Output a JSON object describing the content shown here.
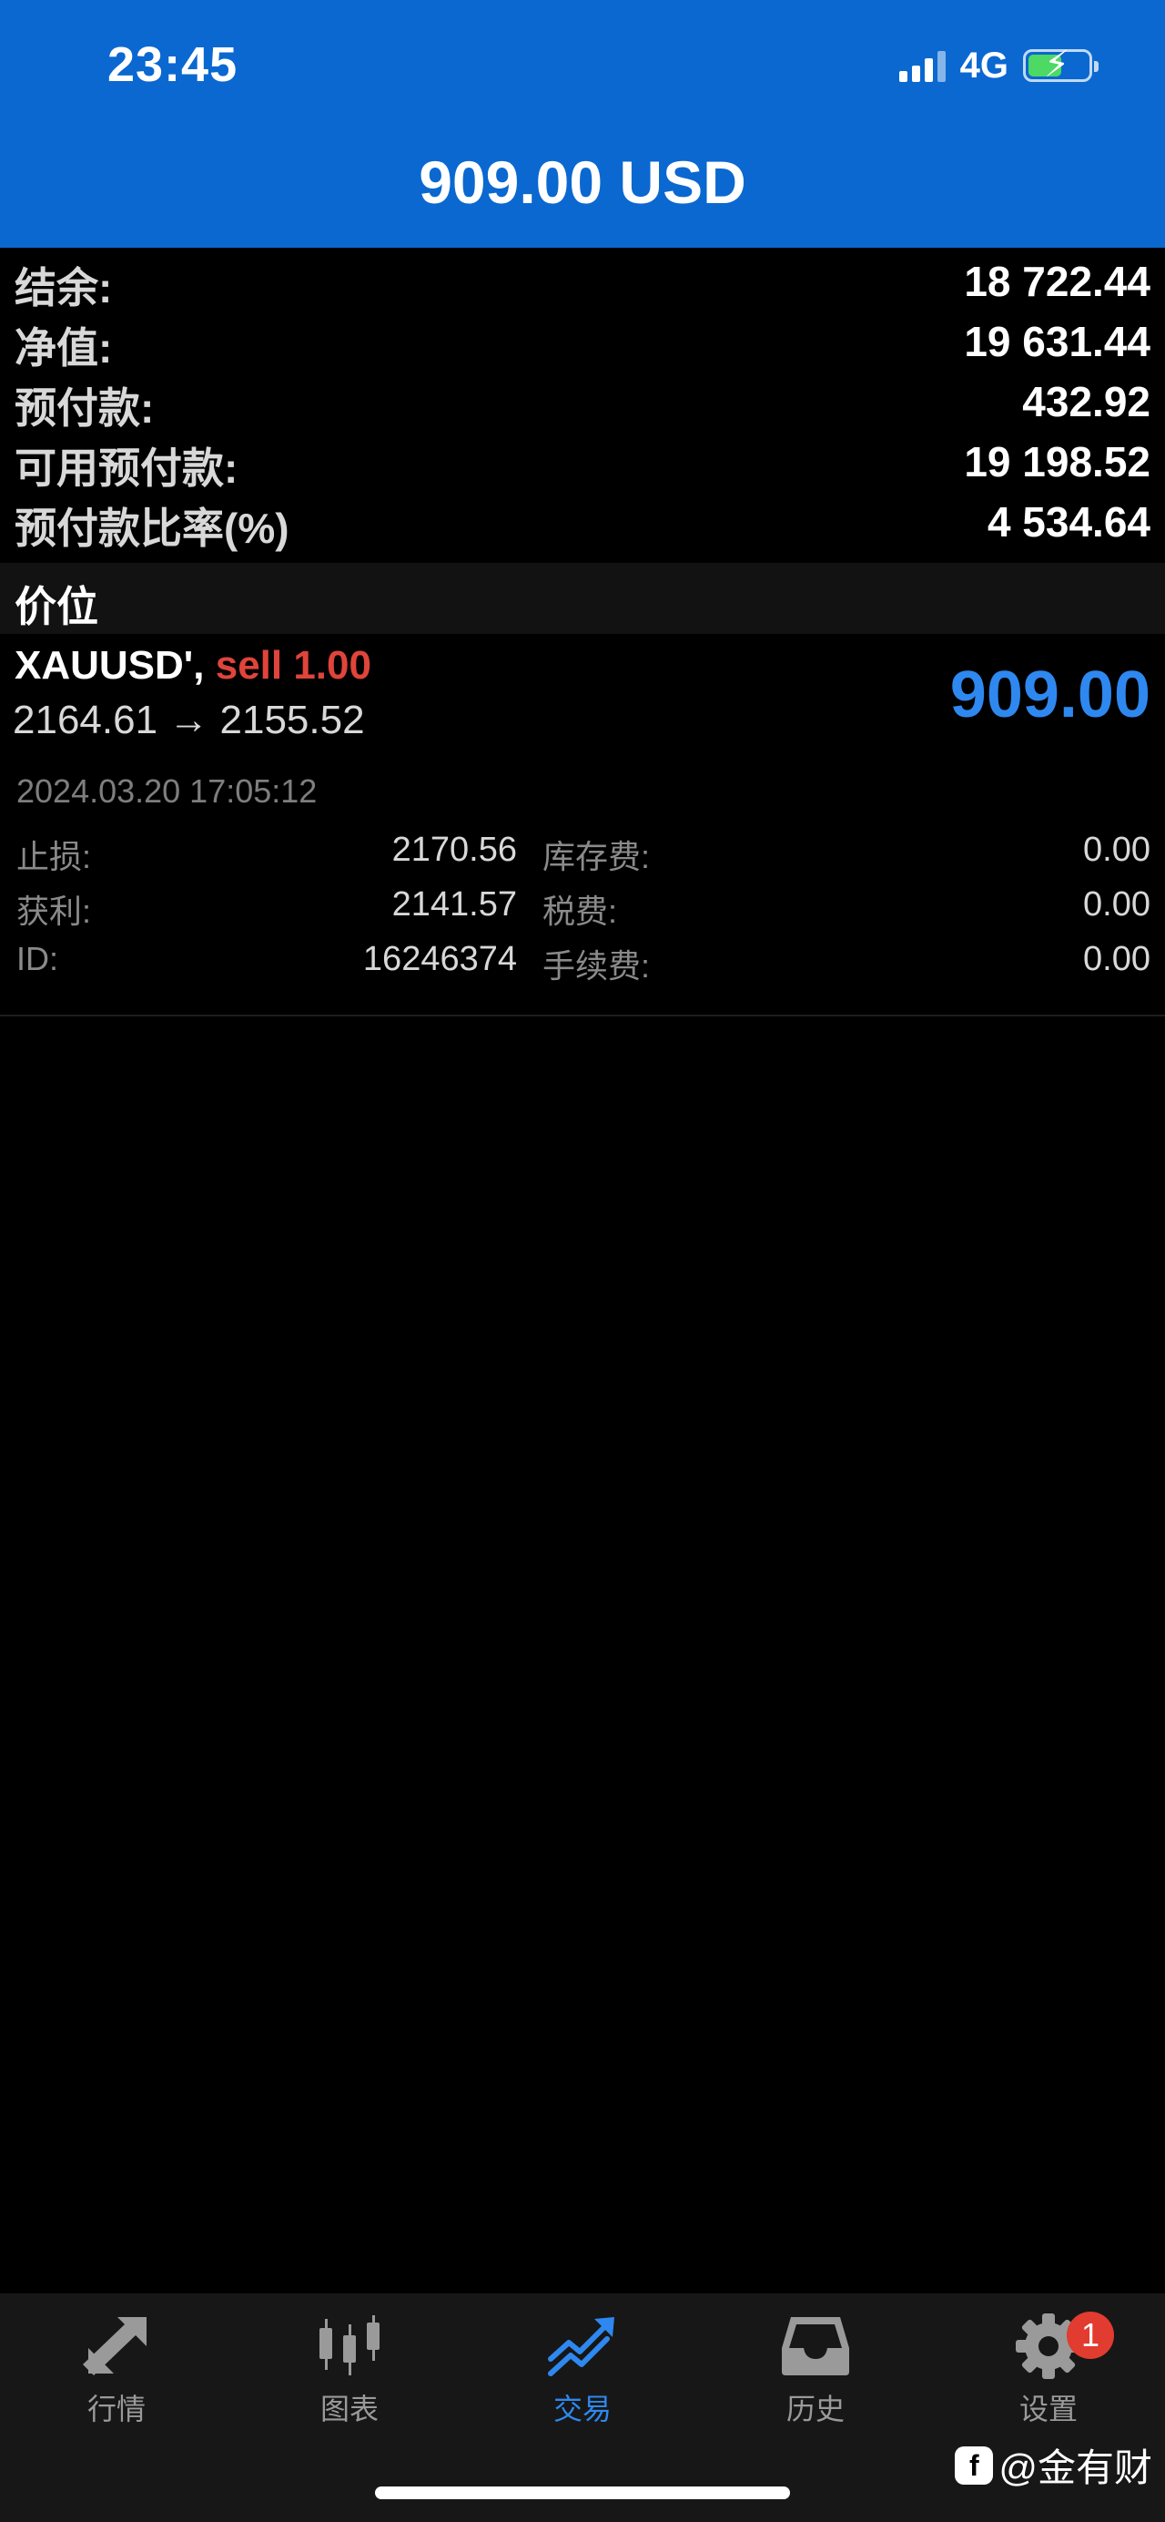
{
  "status_bar": {
    "time": "23:45",
    "network": "4G",
    "battery_level": 0.52
  },
  "header": {
    "total": "909.00 USD"
  },
  "summary": [
    {
      "label": "结余:",
      "value": "18 722.44"
    },
    {
      "label": "净值:",
      "value": "19 631.44"
    },
    {
      "label": "预付款:",
      "value": "432.92"
    },
    {
      "label": "可用预付款:",
      "value": "19 198.52"
    },
    {
      "label": "预付款比率(%)",
      "value": "4 534.64"
    }
  ],
  "section": {
    "title": "价位"
  },
  "position": {
    "symbol": "XAUUSD',",
    "side": "sell 1.00",
    "prices": "2164.61 → 2155.52",
    "profit": "909.00",
    "time": "2024.03.20 17:05:12",
    "details": [
      {
        "label1": "止损:",
        "value1": "2170.56",
        "label2": "库存费:",
        "value2": "0.00"
      },
      {
        "label1": "获利:",
        "value1": "2141.57",
        "label2": "税费:",
        "value2": "0.00"
      },
      {
        "label1": "ID:",
        "value1": "16246374",
        "label2": "手续费:",
        "value2": "0.00"
      }
    ]
  },
  "tabbar": {
    "tabs": [
      {
        "label": "行情",
        "icon": "quotes-arrows-icon",
        "active": false
      },
      {
        "label": "图表",
        "icon": "candlestick-chart-icon",
        "active": false
      },
      {
        "label": "交易",
        "icon": "trade-trend-icon",
        "active": true
      },
      {
        "label": "历史",
        "icon": "history-inbox-icon",
        "active": false
      },
      {
        "label": "设置",
        "icon": "gear-icon",
        "active": false
      }
    ],
    "settings_badge": "1"
  },
  "watermark": {
    "text": "@金有财"
  },
  "colors": {
    "header_bg": "#0a68d0",
    "accent_blue": "#2e88ef",
    "sell_red": "#e0443a",
    "badge_red": "#e23b30"
  }
}
